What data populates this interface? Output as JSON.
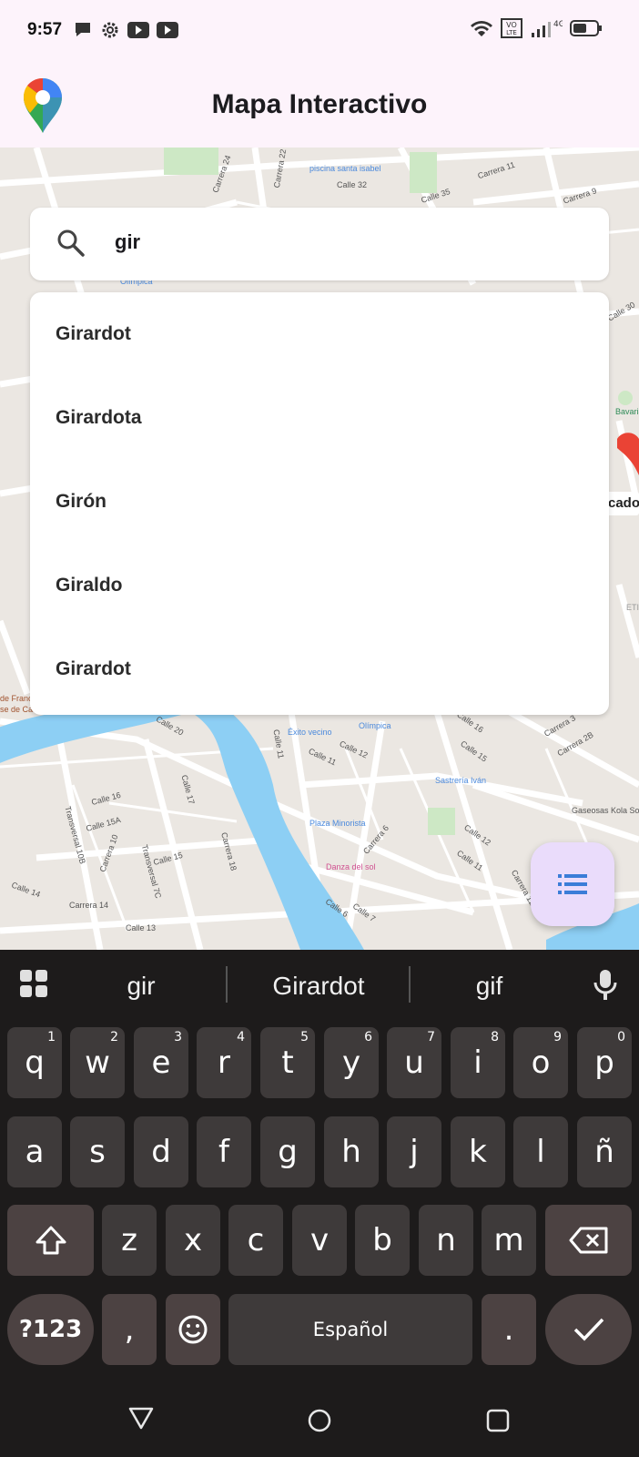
{
  "status_bar": {
    "time": "9:57",
    "network": "4G"
  },
  "app_bar": {
    "title": "Mapa Interactivo"
  },
  "search": {
    "value": "gir"
  },
  "suggestions": [
    "Girardot",
    "Girardota",
    "Girón",
    "Giraldo",
    "Girardot"
  ],
  "map_labels": {
    "l1": "piscina santa isabel",
    "l2": "Calle 32",
    "l3": "Calle 35",
    "l4": "Carrera 11",
    "l5": "Carrera 9",
    "l6": "Carrera 24",
    "l7": "Carrera 22",
    "l8": "Olímpica",
    "l9": "Calle 20",
    "l10": "Éxito vecino",
    "l11": "Olímpica",
    "l12": "Calle 12",
    "l13": "Calle 11",
    "l14": "Calle 16",
    "l15": "Calle 15",
    "l16": "Sastrería Iván",
    "l17": "Plaza Minorista",
    "l18": "Danza del sol",
    "l19": "Calle 16",
    "l20": "Calle 15A",
    "l21": "Transversal 10B",
    "l22": "Carrera 10",
    "l23": "Calle 15",
    "l24": "Calle 14",
    "l25": "Carrera 14",
    "l26": "Calle 13",
    "l27": "Gaseosas Kola Sol",
    "l28": "Carrera 3",
    "l29": "Carrera 2B",
    "l30": "Calle 12",
    "l31": "Calle 11",
    "l32": "Carrera 11A",
    "l33": "Calle 6",
    "l34": "Calle 7",
    "l35": "Bavaria",
    "l36": "cado",
    "l37": "Calle 30",
    "l38": "de Francisco",
    "l39": "se de Caldas",
    "l40": "Carrera 18",
    "l41": "Calle 17",
    "l42": "Carrera 6",
    "l43": "Transversal 7C",
    "l44": "Calle 11",
    "l45": "ETI"
  },
  "keyboard": {
    "suggestions": [
      "gir",
      "Girardot",
      "gif"
    ],
    "row1": [
      {
        "k": "q",
        "n": "1"
      },
      {
        "k": "w",
        "n": "2"
      },
      {
        "k": "e",
        "n": "3"
      },
      {
        "k": "r",
        "n": "4"
      },
      {
        "k": "t",
        "n": "5"
      },
      {
        "k": "y",
        "n": "6"
      },
      {
        "k": "u",
        "n": "7"
      },
      {
        "k": "i",
        "n": "8"
      },
      {
        "k": "o",
        "n": "9"
      },
      {
        "k": "p",
        "n": "0"
      }
    ],
    "row2": [
      "a",
      "s",
      "d",
      "f",
      "g",
      "h",
      "j",
      "k",
      "l",
      "ñ"
    ],
    "row3": [
      "z",
      "x",
      "c",
      "v",
      "b",
      "n",
      "m"
    ],
    "symbols_label": "?123",
    "comma": ",",
    "space_label": "Español",
    "period": "."
  },
  "colors": {
    "accent": "#4a89dc",
    "fab_bg": "#eadcfb",
    "keyboard_bg": "#1d1b1b",
    "key_bg": "#3e3a3a"
  }
}
